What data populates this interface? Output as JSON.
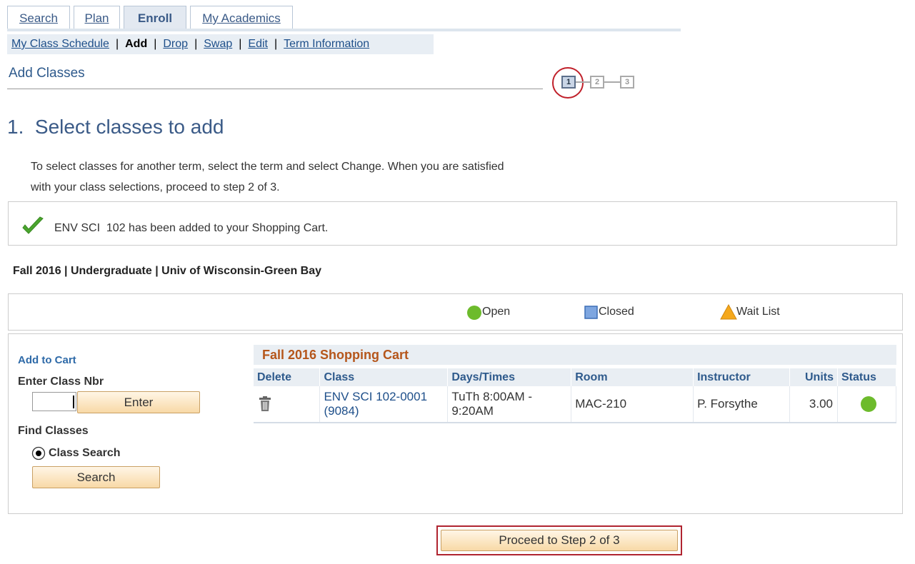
{
  "tabs": [
    {
      "label": "Search",
      "active": false
    },
    {
      "label": "Plan",
      "active": false
    },
    {
      "label": "Enroll",
      "active": true
    },
    {
      "label": "My Academics",
      "active": false
    }
  ],
  "subnav": {
    "my_class_schedule": "My Class Schedule",
    "add": "Add",
    "drop": "Drop",
    "swap": "Swap",
    "edit": "Edit",
    "term_information": "Term Information",
    "separator": "|"
  },
  "page_title": "Add Classes",
  "steps": {
    "one": "1",
    "two": "2",
    "three": "3",
    "current": 1
  },
  "heading": "1.  Select classes to add",
  "instructions": {
    "line1": "To select classes for another term, select the term and select Change.  When you are satisfied",
    "line2": "with your class selections, proceed to step 2 of 3."
  },
  "message": "ENV SCI  102 has been added to your Shopping Cart.",
  "term": "Fall 2016 | Undergraduate | Univ of Wisconsin-Green Bay",
  "legend": {
    "open": "Open",
    "closed": "Closed",
    "wait_list": "Wait List",
    "colors": {
      "open": "#6dbb2c",
      "closed": "#7ea6e0",
      "wait_list": "#f5a81c"
    }
  },
  "add_to_cart": {
    "heading": "Add to Cart",
    "enter_class_nbr_label": "Enter Class Nbr",
    "class_nbr_value": "",
    "enter_button": "Enter",
    "find_classes_label": "Find Classes",
    "class_search_option": "Class Search",
    "search_button": "Search"
  },
  "cart": {
    "title": "Fall 2016 Shopping Cart",
    "columns": [
      "Delete",
      "Class",
      "Days/Times",
      "Room",
      "Instructor",
      "Units",
      "Status"
    ],
    "rows": [
      {
        "class_line1": "ENV SCI 102-0001",
        "class_line2": "(9084)",
        "days_line1": "TuTh 8:00AM -",
        "days_line2": "9:20AM",
        "room": "MAC-210",
        "instructor": "P. Forsythe",
        "units": "3.00",
        "status": "open"
      }
    ]
  },
  "proceed_button": "Proceed to Step 2 of 3"
}
